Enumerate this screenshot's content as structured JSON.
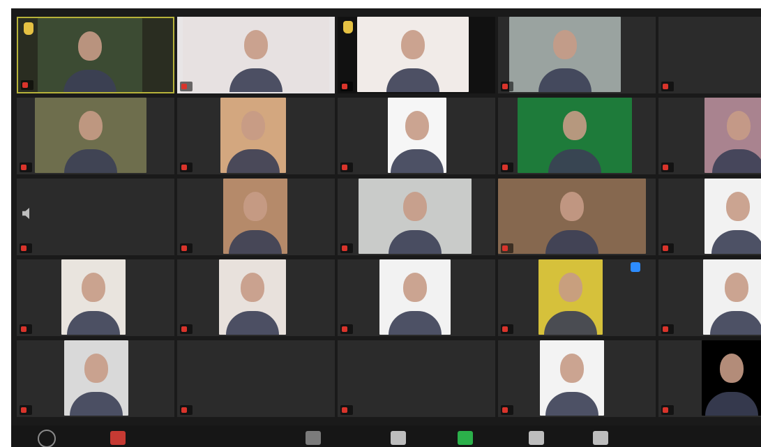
{
  "meeting": {
    "tiles": [
      {
        "name": "",
        "kind": "video",
        "active": true,
        "hand": true,
        "bg": "#2a2d21",
        "vid": "#3c4b33"
      },
      {
        "name": "",
        "kind": "video",
        "bg": "#e8e5e6",
        "vid": "#e7e1e1"
      },
      {
        "name": "",
        "kind": "video",
        "hand": true,
        "bg": "#111111",
        "vid": "#f1ebe8"
      },
      {
        "name": "",
        "kind": "video",
        "bg": "#2b2b2b",
        "vid": "#9aa3a0"
      },
      {
        "name": "",
        "kind": "text",
        "center": "",
        "bg": "#2b2b2b"
      },
      {
        "name": "",
        "kind": "video",
        "bg": "#2b2b2b",
        "vid": "#6e6e4d"
      },
      {
        "name": "",
        "kind": "video",
        "bg": "#2b2b2b",
        "vid": "#d3a77f"
      },
      {
        "name": "",
        "kind": "video",
        "bg": "#2b2b2b",
        "vid": "#f6f6f6"
      },
      {
        "name": "",
        "kind": "video",
        "bg": "#2b2b2b",
        "vid": "#1e7b3a"
      },
      {
        "name": "",
        "kind": "video",
        "bg": "#2b2b2b",
        "vid": "#a9838f"
      },
      {
        "name": "",
        "kind": "text",
        "center": "",
        "speaker": true,
        "bg": "#2b2b2b"
      },
      {
        "name": "",
        "kind": "video",
        "bg": "#2b2b2b",
        "vid": "#b58a6a"
      },
      {
        "name": "",
        "kind": "video",
        "bg": "#2b2b2b",
        "vid": "#c9cbc9"
      },
      {
        "name": "",
        "kind": "video",
        "bg": "#2b2b2b",
        "vid": "#86684f"
      },
      {
        "name": "",
        "kind": "video",
        "bg": "#2b2b2b",
        "vid": "#f2f2f2"
      },
      {
        "name": "",
        "kind": "video",
        "bg": "#2b2b2b",
        "vid": "#e9e4de"
      },
      {
        "name": "",
        "kind": "video",
        "bg": "#2b2b2b",
        "vid": "#e8e1dc"
      },
      {
        "name": "",
        "kind": "video",
        "bg": "#2b2b2b",
        "vid": "#f2f2f2"
      },
      {
        "name": "",
        "kind": "video",
        "bg": "#2b2b2b",
        "vid": "#d6c13b",
        "share": true
      },
      {
        "name": "",
        "kind": "video",
        "bg": "#2b2b2b",
        "vid": "#f1f1f1"
      },
      {
        "name": "",
        "kind": "video",
        "bg": "#2b2b2b",
        "vid": "#d9d9d9"
      },
      {
        "name": "",
        "kind": "text",
        "center": "",
        "bg": "#2b2b2b"
      },
      {
        "name": "",
        "kind": "text",
        "center": "",
        "bg": "#2b2b2b"
      },
      {
        "name": "",
        "kind": "video",
        "bg": "#2b2b2b",
        "vid": "#f3f3f3"
      },
      {
        "name": "",
        "kind": "video",
        "bg": "#2b2b2b",
        "vid": "#000000"
      }
    ]
  },
  "toolbar": {
    "items": [
      {
        "name": "mute-audio"
      },
      {
        "name": "stop-video"
      },
      {
        "name": "participants"
      },
      {
        "name": "chat"
      },
      {
        "name": "share-screen"
      },
      {
        "name": "record"
      },
      {
        "name": "reactions"
      }
    ]
  }
}
